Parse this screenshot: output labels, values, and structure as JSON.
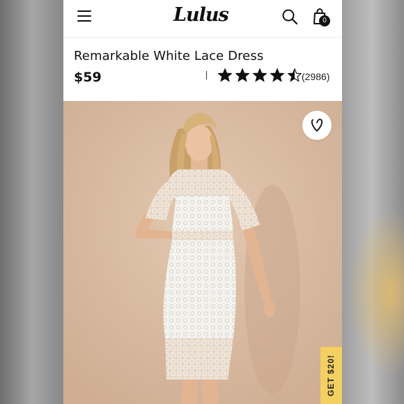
{
  "brand": {
    "logo_text": "Lulus"
  },
  "header": {
    "menu_icon": "hamburger-menu-icon",
    "search_icon": "search-icon",
    "bag_icon": "shopping-bag-icon",
    "bag_count": "0"
  },
  "product": {
    "name": "Remarkable White Lace Dress",
    "price": "$59",
    "rating": 4.5,
    "rating_max": 5,
    "review_count": "(2986)",
    "favorite_icon": "heart-icon"
  },
  "promo": {
    "label": "GET $20!"
  },
  "colors": {
    "text": "#111111",
    "promo_bg": "#f4cf62",
    "hero_bg": "#d9bca2"
  }
}
